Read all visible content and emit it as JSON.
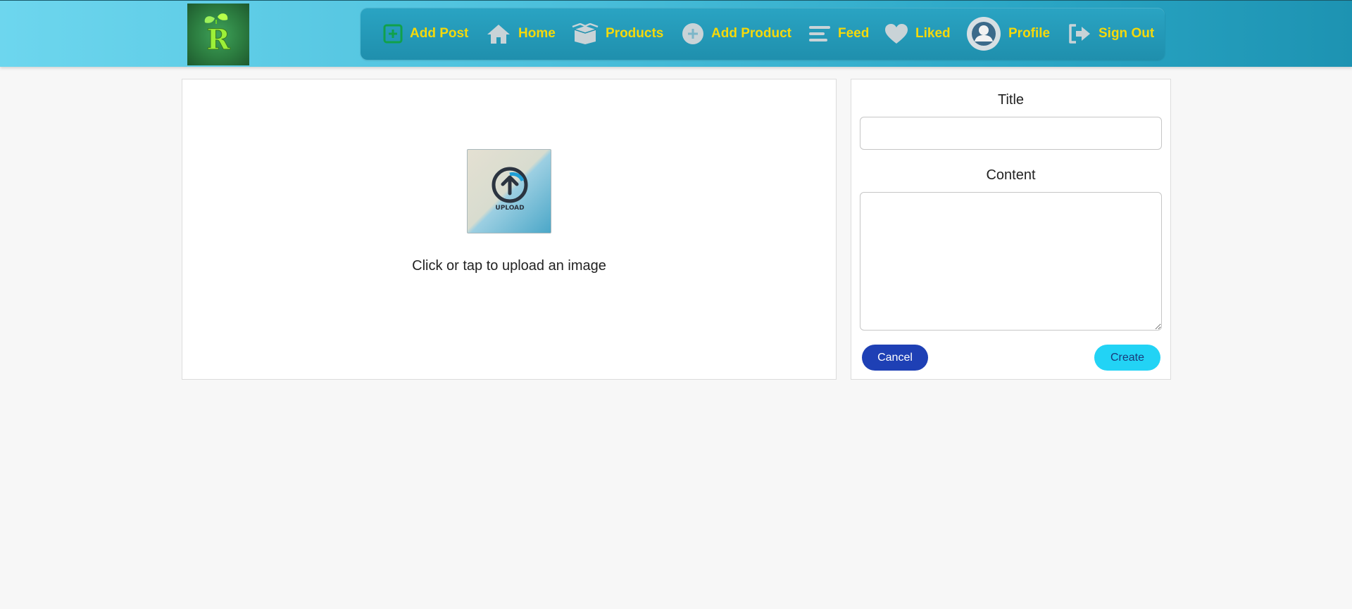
{
  "header": {
    "logo_letter": "R",
    "nav": [
      {
        "label": "Add Post",
        "icon": "add-square-icon"
      },
      {
        "label": "Home",
        "icon": "home-icon"
      },
      {
        "label": "Products",
        "icon": "box-icon"
      },
      {
        "label": "Add Product",
        "icon": "add-circle-icon"
      },
      {
        "label": "Feed",
        "icon": "menu-lines-icon"
      },
      {
        "label": "Liked",
        "icon": "heart-icon"
      },
      {
        "label": "Profile",
        "icon": "avatar-icon"
      },
      {
        "label": "Sign Out",
        "icon": "sign-out-icon"
      }
    ],
    "colors": {
      "nav_text": "#f5d90a",
      "header_start": "#6dd6ee",
      "header_end": "#1d93b2"
    }
  },
  "upload": {
    "thumb_text": "UPLOAD",
    "prompt": "Click or tap to upload an image"
  },
  "form": {
    "title_label": "Title",
    "title_value": "",
    "content_label": "Content",
    "content_value": "",
    "cancel_label": "Cancel",
    "create_label": "Create",
    "colors": {
      "cancel": "#1e40b5",
      "create": "#22d3f5"
    }
  }
}
